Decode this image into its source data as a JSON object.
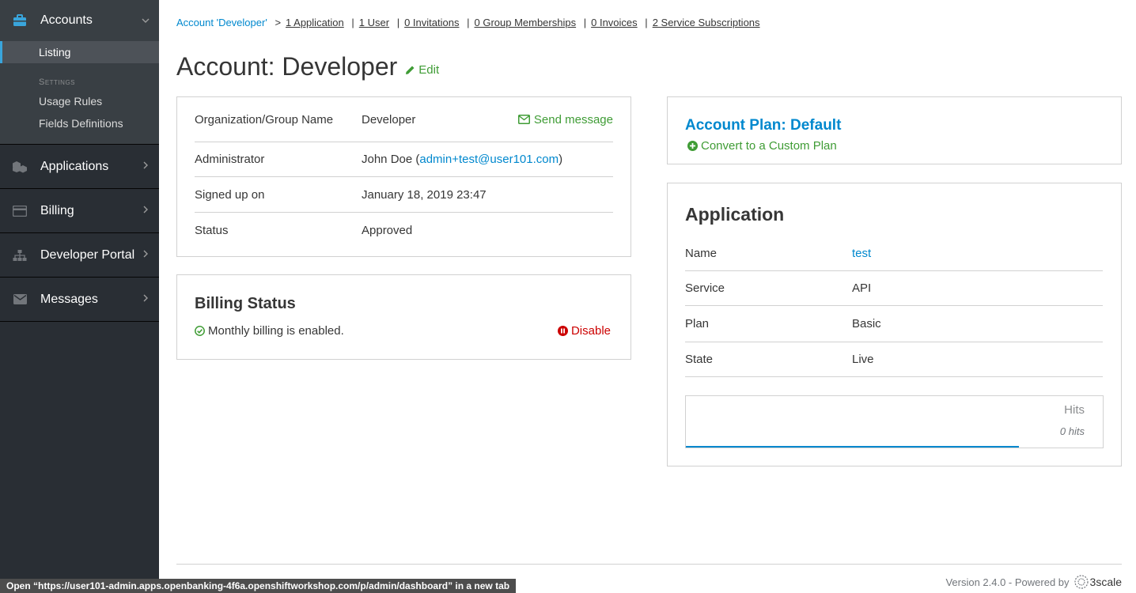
{
  "sidebar": {
    "accounts": {
      "label": "Accounts",
      "items": {
        "listing": "Listing"
      },
      "settings_heading": "Settings",
      "settings": {
        "usage_rules": "Usage Rules",
        "fields_definitions": "Fields Definitions"
      }
    },
    "applications": "Applications",
    "billing": "Billing",
    "developer_portal": "Developer Portal",
    "messages": "Messages"
  },
  "breadcrumb": {
    "account": "Account 'Developer'",
    "arrow": ">",
    "applications": "1 Application",
    "users": "1 User",
    "invitations": "0 Invitations",
    "group_memberships": "0 Group Memberships",
    "invoices": "0 Invoices",
    "service_subscriptions": "2 Service Subscriptions"
  },
  "page": {
    "title": "Account: Developer",
    "edit": "Edit"
  },
  "account_details": {
    "org_key": "Organization/Group Name",
    "org_val": "Developer",
    "send_message": "Send message",
    "admin_key": "Administrator",
    "admin_name": "John Doe (",
    "admin_email": "admin+test@user101.com",
    "admin_close": ")",
    "signed_key": "Signed up on",
    "signed_val": "January 18, 2019 23:47",
    "status_key": "Status",
    "status_val": "Approved"
  },
  "billing_status": {
    "title": "Billing Status",
    "message": "Monthly billing is enabled.",
    "disable": "Disable"
  },
  "account_plan": {
    "title": "Account Plan: Default",
    "convert": "Convert to a Custom Plan"
  },
  "application": {
    "title": "Application",
    "name_key": "Name",
    "name_val": "test",
    "service_key": "Service",
    "service_val": "API",
    "plan_key": "Plan",
    "plan_val": "Basic",
    "state_key": "State",
    "state_val": "Live",
    "hits_label": "Hits",
    "hits_count": "0 hits"
  },
  "footer": {
    "version": "Version 2.4.0 - Powered by",
    "brand": "3scale"
  },
  "status_bar": "Open “https://user101-admin.apps.openbanking-4f6a.openshiftworkshop.com/p/admin/dashboard” in a new tab",
  "colors": {
    "accent_blue": "#0088ce",
    "success_green": "#3f9c35",
    "danger_red": "#cc0000",
    "sidebar_bg": "#292e34"
  }
}
